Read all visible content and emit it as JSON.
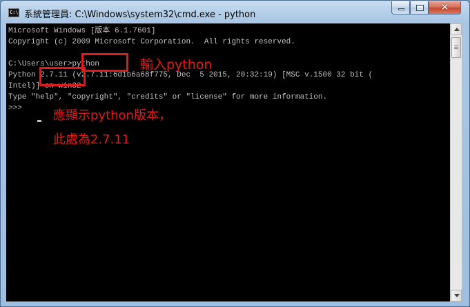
{
  "window": {
    "title": "系統管理員: C:\\Windows\\system32\\cmd.exe - python",
    "icon_label": "C:\\",
    "close_glyph": "✕"
  },
  "console": {
    "lines": [
      "Microsoft Windows [版本 6.1.7601]",
      "Copyright (c) 2009 Microsoft Corporation.  All rights reserved.",
      "",
      "C:\\Users\\user>python",
      "Python 2.7.11 (v2.7.11:6d1b6a68f775, Dec  5 2015, 20:32:19) [MSC v.1500 32 bit (",
      "Intel)] on win32",
      "Type \"help\", \"copyright\", \"credits\" or \"license\" for more information.",
      ">>> "
    ]
  },
  "annotations": {
    "input_note": "輸入python",
    "version_note_line1": "應顯示python版本，",
    "version_note_line2": "此處為2.7.11",
    "color": "#e31a1a"
  },
  "colors": {
    "console_bg": "#000000",
    "console_fg": "#c0c0c0"
  }
}
